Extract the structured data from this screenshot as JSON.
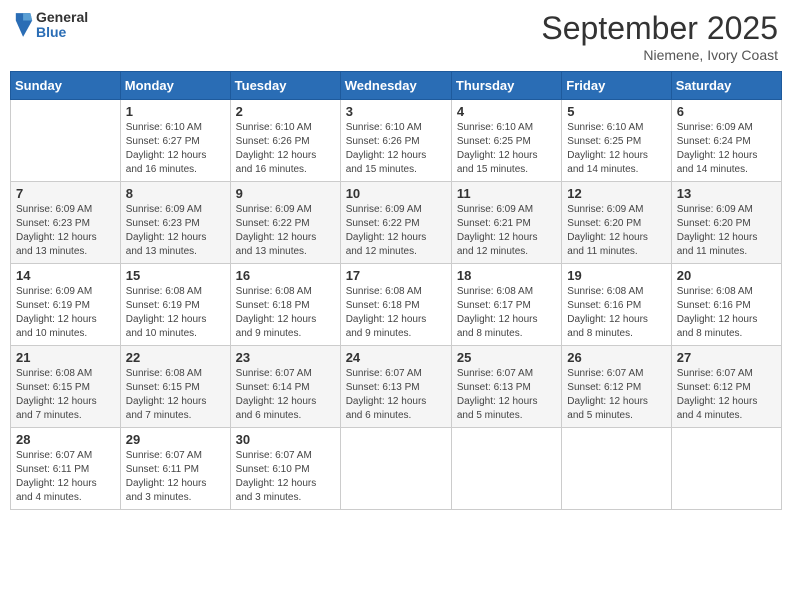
{
  "header": {
    "logo": {
      "general": "General",
      "blue": "Blue"
    },
    "title": "September 2025",
    "subtitle": "Niemene, Ivory Coast"
  },
  "weekdays": [
    "Sunday",
    "Monday",
    "Tuesday",
    "Wednesday",
    "Thursday",
    "Friday",
    "Saturday"
  ],
  "weeks": [
    [
      {
        "day": "",
        "info": ""
      },
      {
        "day": "1",
        "info": "Sunrise: 6:10 AM\nSunset: 6:27 PM\nDaylight: 12 hours\nand 16 minutes."
      },
      {
        "day": "2",
        "info": "Sunrise: 6:10 AM\nSunset: 6:26 PM\nDaylight: 12 hours\nand 16 minutes."
      },
      {
        "day": "3",
        "info": "Sunrise: 6:10 AM\nSunset: 6:26 PM\nDaylight: 12 hours\nand 15 minutes."
      },
      {
        "day": "4",
        "info": "Sunrise: 6:10 AM\nSunset: 6:25 PM\nDaylight: 12 hours\nand 15 minutes."
      },
      {
        "day": "5",
        "info": "Sunrise: 6:10 AM\nSunset: 6:25 PM\nDaylight: 12 hours\nand 14 minutes."
      },
      {
        "day": "6",
        "info": "Sunrise: 6:09 AM\nSunset: 6:24 PM\nDaylight: 12 hours\nand 14 minutes."
      }
    ],
    [
      {
        "day": "7",
        "info": "Sunrise: 6:09 AM\nSunset: 6:23 PM\nDaylight: 12 hours\nand 13 minutes."
      },
      {
        "day": "8",
        "info": "Sunrise: 6:09 AM\nSunset: 6:23 PM\nDaylight: 12 hours\nand 13 minutes."
      },
      {
        "day": "9",
        "info": "Sunrise: 6:09 AM\nSunset: 6:22 PM\nDaylight: 12 hours\nand 13 minutes."
      },
      {
        "day": "10",
        "info": "Sunrise: 6:09 AM\nSunset: 6:22 PM\nDaylight: 12 hours\nand 12 minutes."
      },
      {
        "day": "11",
        "info": "Sunrise: 6:09 AM\nSunset: 6:21 PM\nDaylight: 12 hours\nand 12 minutes."
      },
      {
        "day": "12",
        "info": "Sunrise: 6:09 AM\nSunset: 6:20 PM\nDaylight: 12 hours\nand 11 minutes."
      },
      {
        "day": "13",
        "info": "Sunrise: 6:09 AM\nSunset: 6:20 PM\nDaylight: 12 hours\nand 11 minutes."
      }
    ],
    [
      {
        "day": "14",
        "info": "Sunrise: 6:09 AM\nSunset: 6:19 PM\nDaylight: 12 hours\nand 10 minutes."
      },
      {
        "day": "15",
        "info": "Sunrise: 6:08 AM\nSunset: 6:19 PM\nDaylight: 12 hours\nand 10 minutes."
      },
      {
        "day": "16",
        "info": "Sunrise: 6:08 AM\nSunset: 6:18 PM\nDaylight: 12 hours\nand 9 minutes."
      },
      {
        "day": "17",
        "info": "Sunrise: 6:08 AM\nSunset: 6:18 PM\nDaylight: 12 hours\nand 9 minutes."
      },
      {
        "day": "18",
        "info": "Sunrise: 6:08 AM\nSunset: 6:17 PM\nDaylight: 12 hours\nand 8 minutes."
      },
      {
        "day": "19",
        "info": "Sunrise: 6:08 AM\nSunset: 6:16 PM\nDaylight: 12 hours\nand 8 minutes."
      },
      {
        "day": "20",
        "info": "Sunrise: 6:08 AM\nSunset: 6:16 PM\nDaylight: 12 hours\nand 8 minutes."
      }
    ],
    [
      {
        "day": "21",
        "info": "Sunrise: 6:08 AM\nSunset: 6:15 PM\nDaylight: 12 hours\nand 7 minutes."
      },
      {
        "day": "22",
        "info": "Sunrise: 6:08 AM\nSunset: 6:15 PM\nDaylight: 12 hours\nand 7 minutes."
      },
      {
        "day": "23",
        "info": "Sunrise: 6:07 AM\nSunset: 6:14 PM\nDaylight: 12 hours\nand 6 minutes."
      },
      {
        "day": "24",
        "info": "Sunrise: 6:07 AM\nSunset: 6:13 PM\nDaylight: 12 hours\nand 6 minutes."
      },
      {
        "day": "25",
        "info": "Sunrise: 6:07 AM\nSunset: 6:13 PM\nDaylight: 12 hours\nand 5 minutes."
      },
      {
        "day": "26",
        "info": "Sunrise: 6:07 AM\nSunset: 6:12 PM\nDaylight: 12 hours\nand 5 minutes."
      },
      {
        "day": "27",
        "info": "Sunrise: 6:07 AM\nSunset: 6:12 PM\nDaylight: 12 hours\nand 4 minutes."
      }
    ],
    [
      {
        "day": "28",
        "info": "Sunrise: 6:07 AM\nSunset: 6:11 PM\nDaylight: 12 hours\nand 4 minutes."
      },
      {
        "day": "29",
        "info": "Sunrise: 6:07 AM\nSunset: 6:11 PM\nDaylight: 12 hours\nand 3 minutes."
      },
      {
        "day": "30",
        "info": "Sunrise: 6:07 AM\nSunset: 6:10 PM\nDaylight: 12 hours\nand 3 minutes."
      },
      {
        "day": "",
        "info": ""
      },
      {
        "day": "",
        "info": ""
      },
      {
        "day": "",
        "info": ""
      },
      {
        "day": "",
        "info": ""
      }
    ]
  ]
}
